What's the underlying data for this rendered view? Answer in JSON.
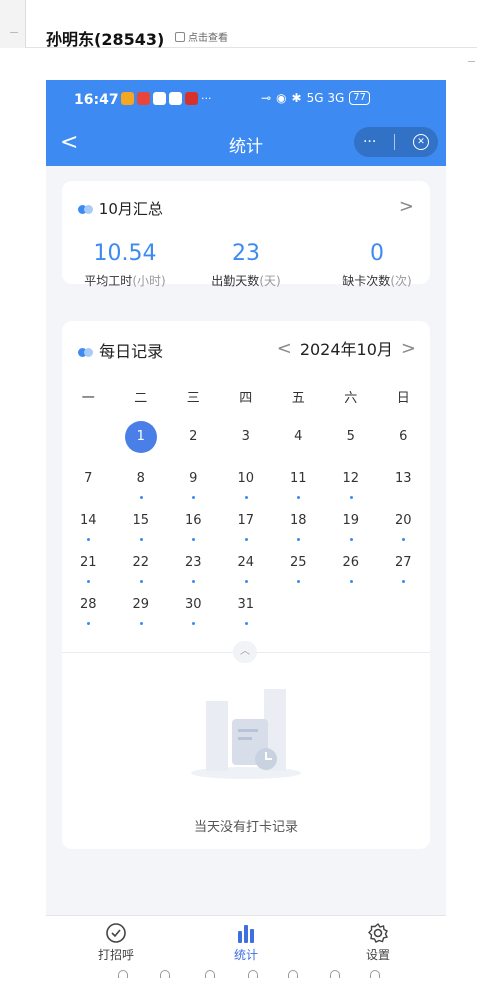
{
  "window": {
    "title": "孙明东(28543)",
    "view_label": "点击查看"
  },
  "statusbar": {
    "time": "16:47",
    "icons_text": "···",
    "signal_text": "5G 3G",
    "battery": "77"
  },
  "navbar": {
    "back_glyph": "<",
    "title": "统计",
    "more_glyph": "···",
    "close_glyph": "✕"
  },
  "summary": {
    "title": "10月汇总",
    "chevron": ">",
    "stats": [
      {
        "value": "10.54",
        "label": "平均工时",
        "unit": "(小时)"
      },
      {
        "value": "23",
        "label": "出勤天数",
        "unit": "(天)"
      },
      {
        "value": "0",
        "label": "缺卡次数",
        "unit": "(次)"
      }
    ]
  },
  "daily": {
    "title": "每日记录",
    "prev_glyph": "<",
    "next_glyph": ">",
    "month_label": "2024年10月",
    "weekdays": [
      "一",
      "二",
      "三",
      "四",
      "五",
      "六",
      "日"
    ],
    "selected_day": 1,
    "first_weekday_index": 1,
    "days_in_month": 31,
    "marked_days": [
      8,
      9,
      10,
      11,
      12,
      14,
      15,
      16,
      17,
      18,
      19,
      20,
      21,
      22,
      23,
      24,
      25,
      26,
      27,
      28,
      29,
      30,
      31
    ],
    "empty_text": "当天没有打卡记录"
  },
  "tabbar": {
    "items": [
      {
        "label": "打招呼",
        "icon": "check-circle-icon",
        "active": false
      },
      {
        "label": "统计",
        "icon": "bar-chart-icon",
        "active": true
      },
      {
        "label": "设置",
        "icon": "gear-icon",
        "active": false
      }
    ]
  },
  "colors": {
    "primary": "#3d8bf2",
    "selected": "#4a7fe8",
    "background": "#f3f5f8"
  }
}
